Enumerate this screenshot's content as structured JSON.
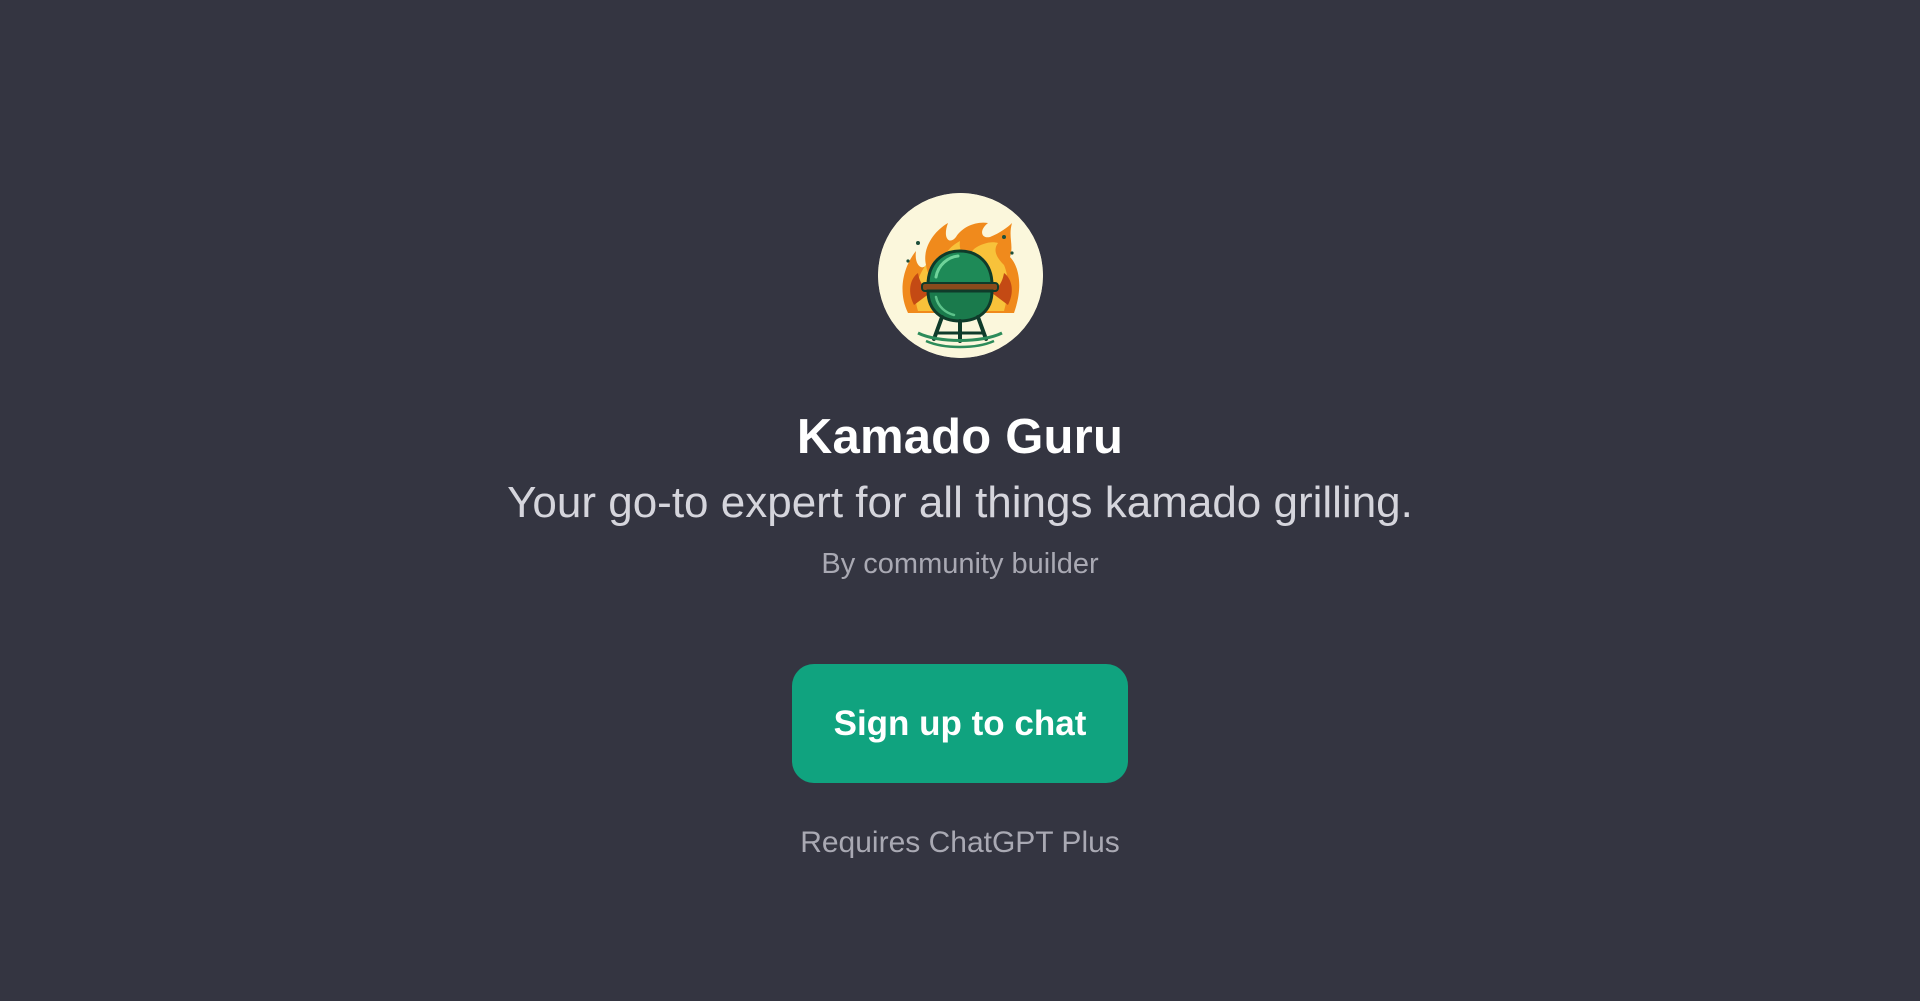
{
  "gpt": {
    "logo_icon": "kamado-grill-flames-icon",
    "name": "Kamado Guru",
    "description": "Your go-to expert for all things kamado grilling.",
    "author": "By community builder"
  },
  "actions": {
    "signup_label": "Sign up to chat",
    "requirement_note": "Requires ChatGPT Plus"
  },
  "colors": {
    "background": "#343541",
    "accent": "#10a37f",
    "title": "#ffffff",
    "subtitle": "#d5d5dc",
    "muted": "#a9a9b3"
  }
}
